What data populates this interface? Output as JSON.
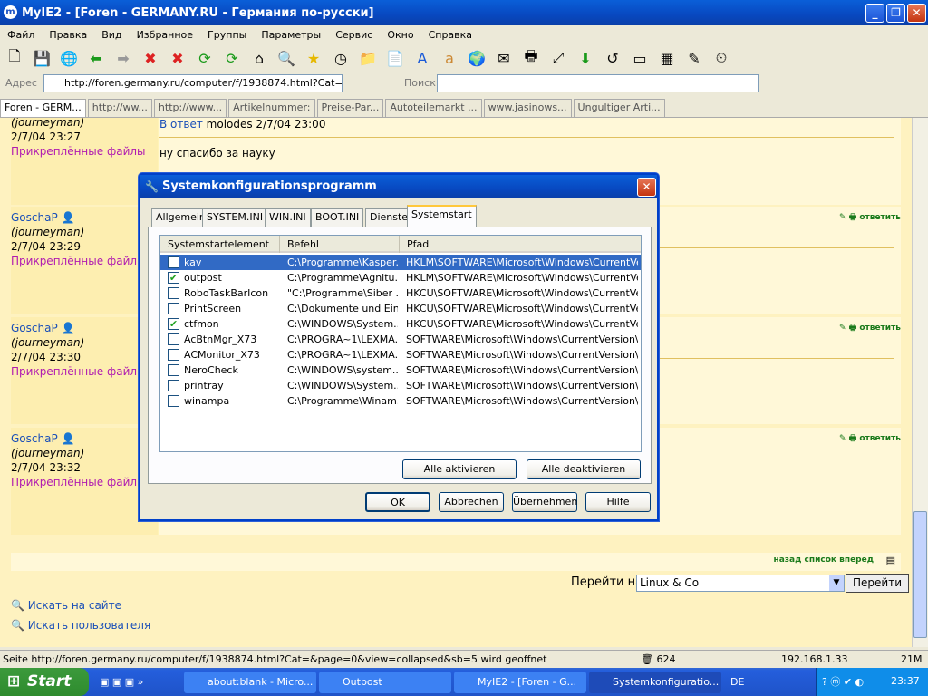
{
  "window": {
    "title": "MyIE2 - [Foren - GERMANY.RU - Германия по-русски]"
  },
  "menu": [
    "Файл",
    "Правка",
    "Вид",
    "Избранное",
    "Группы",
    "Параметры",
    "Сервис",
    "Окно",
    "Справка"
  ],
  "address": {
    "label": "Адрес",
    "url": "http://foren.germany.ru/computer/f/1938874.html?Cat=&page",
    "search_label": "Поиск"
  },
  "tabs": [
    "Foren - GERM...",
    "http://ww...",
    "http://www...",
    "Artikelnummer:",
    "Preise-Par...",
    "Autoteilemarkt ...",
    "www.jasinows...",
    "Ungultiger Arti..."
  ],
  "posts": [
    {
      "level": "(journeyman)",
      "date": "2/7/04 23:27",
      "attach": "Прикреплённые файлы",
      "reply_prefix": "В ответ",
      "reply_to": "molodes 2/7/04 23:00",
      "body": "ну спасибо за науку"
    },
    {
      "user": "GoschaP",
      "level": "(journeyman)",
      "date": "2/7/04 23:29",
      "attach": "Прикреплённые файлы",
      "action": "ответить"
    },
    {
      "user": "GoschaP",
      "level": "(journeyman)",
      "date": "2/7/04 23:30",
      "attach": "Прикреплённые файлы",
      "action": "ответить"
    },
    {
      "user": "GoschaP",
      "level": "(journeyman)",
      "date": "2/7/04 23:32",
      "attach": "Прикреплённые файлы",
      "action": "ответить"
    }
  ],
  "nav": {
    "back": "назад",
    "list": "список",
    "forward": "вперед",
    "goto_label": "Перейти на",
    "goto_value": "Linux & Co",
    "goto_button": "Перейти",
    "search_site": "Искать на сайте",
    "search_user": "Искать пользователя"
  },
  "dialog": {
    "title": "Systemkonfigurationsprogramm",
    "tabs": [
      "Allgemein",
      "SYSTEM.INI",
      "WIN.INI",
      "BOOT.INI",
      "Dienste",
      "Systemstart"
    ],
    "active_tab": "Systemstart",
    "columns": [
      "Systemstartelement",
      "Befehl",
      "Pfad"
    ],
    "rows": [
      {
        "name": "kav",
        "cmd": "C:\\Programme\\Kasper...",
        "path": "HKLM\\SOFTWARE\\Microsoft\\Windows\\CurrentVer...",
        "checked": false,
        "selected": true
      },
      {
        "name": "outpost",
        "cmd": "C:\\Programme\\Agnitu...",
        "path": "HKLM\\SOFTWARE\\Microsoft\\Windows\\CurrentVer...",
        "checked": true,
        "selected": false
      },
      {
        "name": "RoboTaskBarIcon",
        "cmd": "\"C:\\Programme\\Siber ...",
        "path": "HKCU\\SOFTWARE\\Microsoft\\Windows\\CurrentVer...",
        "checked": false,
        "selected": false
      },
      {
        "name": "PrintScreen",
        "cmd": "C:\\Dokumente und Ein...",
        "path": "HKCU\\SOFTWARE\\Microsoft\\Windows\\CurrentVer...",
        "checked": false,
        "selected": false
      },
      {
        "name": "ctfmon",
        "cmd": "C:\\WINDOWS\\System...",
        "path": "HKCU\\SOFTWARE\\Microsoft\\Windows\\CurrentVer...",
        "checked": true,
        "selected": false
      },
      {
        "name": "AcBtnMgr_X73",
        "cmd": "C:\\PROGRA~1\\LEXMA...",
        "path": "SOFTWARE\\Microsoft\\Windows\\CurrentVersion\\Run",
        "checked": false,
        "selected": false
      },
      {
        "name": "ACMonitor_X73",
        "cmd": "C:\\PROGRA~1\\LEXMA...",
        "path": "SOFTWARE\\Microsoft\\Windows\\CurrentVersion\\Run",
        "checked": false,
        "selected": false
      },
      {
        "name": "NeroCheck",
        "cmd": "C:\\WINDOWS\\system...",
        "path": "SOFTWARE\\Microsoft\\Windows\\CurrentVersion\\Run",
        "checked": false,
        "selected": false
      },
      {
        "name": "printray",
        "cmd": "C:\\WINDOWS\\System...",
        "path": "SOFTWARE\\Microsoft\\Windows\\CurrentVersion\\Run",
        "checked": false,
        "selected": false
      },
      {
        "name": "winampa",
        "cmd": "C:\\Programme\\Winam...",
        "path": "SOFTWARE\\Microsoft\\Windows\\CurrentVersion\\Run",
        "checked": false,
        "selected": false
      }
    ],
    "buttons": {
      "enable_all": "Alle aktivieren",
      "disable_all": "Alle deaktivieren",
      "ok": "OK",
      "cancel": "Abbrechen",
      "apply": "Übernehmen",
      "help": "Hilfe"
    }
  },
  "status": {
    "text": "Seite http://foren.germany.ru/computer/f/1938874.html?Cat=&page=0&view=collapsed&sb=5 wird geoffnet",
    "count": "624",
    "ip": "192.168.1.33",
    "mem": "21M"
  },
  "taskbar": {
    "start": "Start",
    "tasks": [
      "about:blank - Micro...",
      "Outpost",
      "MyIE2 - [Foren - G...",
      "Systemkonfiguratio..."
    ],
    "lang": "DE",
    "clock": "23:37"
  }
}
